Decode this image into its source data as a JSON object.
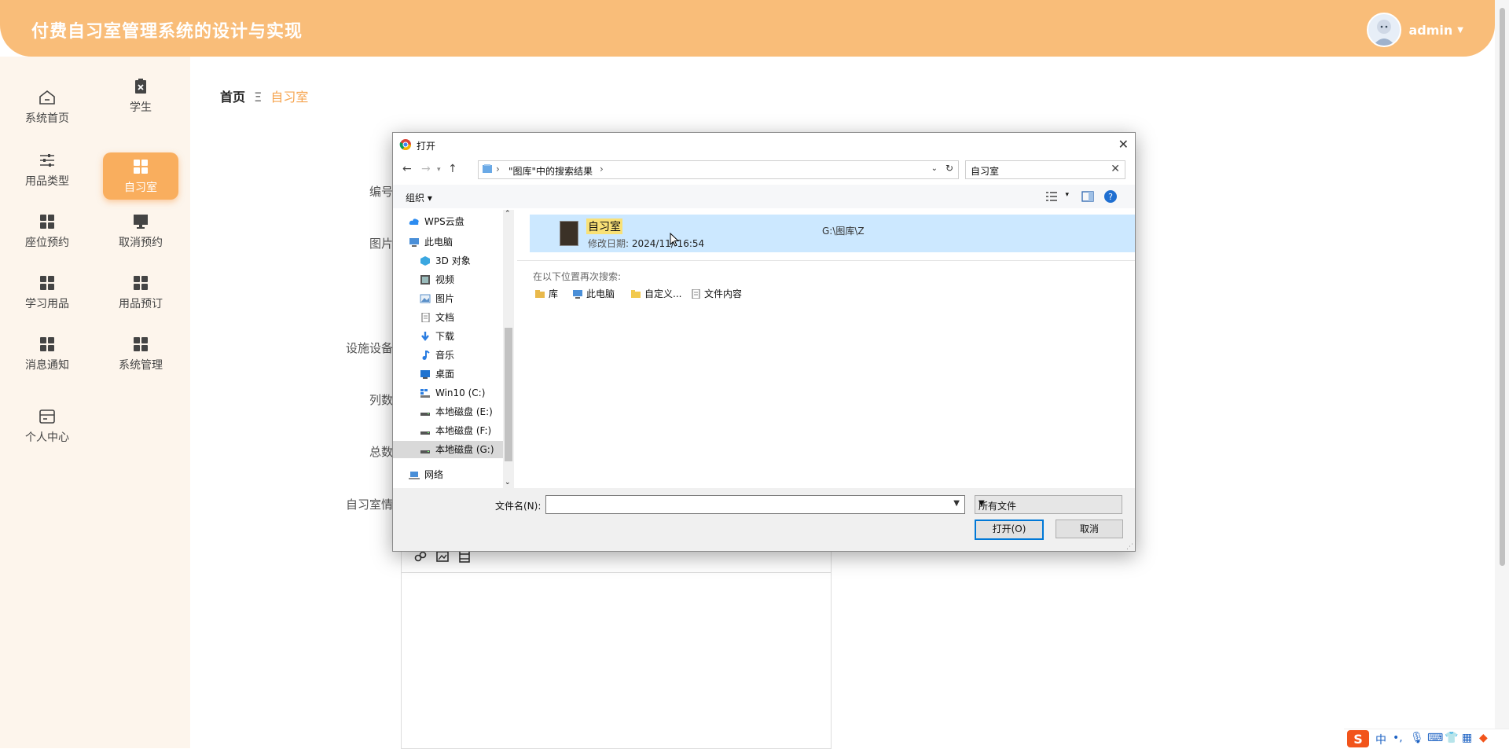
{
  "header": {
    "title": "付费自习室管理系统的设计与实现",
    "user": "admin"
  },
  "sidebar": {
    "items": [
      {
        "label": "系统首页",
        "icon": "home-icon"
      },
      {
        "label": "学生",
        "icon": "clipboard-icon"
      },
      {
        "label": "用品类型",
        "icon": "sliders-icon"
      },
      {
        "label": "自习室",
        "icon": "grid-icon",
        "active": true
      },
      {
        "label": "座位预约",
        "icon": "grid-icon"
      },
      {
        "label": "取消预约",
        "icon": "monitor-icon"
      },
      {
        "label": "学习用品",
        "icon": "grid-icon"
      },
      {
        "label": "用品预订",
        "icon": "grid-icon"
      },
      {
        "label": "消息通知",
        "icon": "grid-icon"
      },
      {
        "label": "系统管理",
        "icon": "grid-icon"
      },
      {
        "label": "个人中心",
        "icon": "card-icon"
      }
    ]
  },
  "breadcrumb": {
    "home": "首页",
    "separator": "Ξ",
    "current": "自习室"
  },
  "form": {
    "labels": {
      "number": "编号",
      "picture": "图片",
      "facilities": "设施设备",
      "columns": "列数",
      "total": "总数",
      "details": "自习室情"
    }
  },
  "dialog": {
    "title": "打开",
    "address": {
      "text": "\"图库\"中的搜索结果"
    },
    "search": {
      "value": "自习室"
    },
    "organize": "组织",
    "tree": [
      {
        "label": "WPS云盘",
        "icon": "cloud-icon"
      },
      {
        "label": "此电脑",
        "icon": "computer-icon"
      },
      {
        "label": "3D 对象",
        "icon": "cube-icon"
      },
      {
        "label": "视频",
        "icon": "video-icon"
      },
      {
        "label": "图片",
        "icon": "picture-icon"
      },
      {
        "label": "文档",
        "icon": "document-icon"
      },
      {
        "label": "下载",
        "icon": "download-icon"
      },
      {
        "label": "音乐",
        "icon": "music-icon"
      },
      {
        "label": "桌面",
        "icon": "desktop-icon"
      },
      {
        "label": "Win10 (C:)",
        "icon": "windows-drive-icon"
      },
      {
        "label": "本地磁盘 (E:)",
        "icon": "drive-icon"
      },
      {
        "label": "本地磁盘 (F:)",
        "icon": "drive-icon"
      },
      {
        "label": "本地磁盘 (G:)",
        "icon": "drive-icon",
        "selected": true
      },
      {
        "label": "网络",
        "icon": "network-icon"
      }
    ],
    "result": {
      "name": "自习室",
      "modified_label": "修改日期:",
      "modified": "2024/11/",
      "time": "16:54",
      "path": "G:\\图库\\Z"
    },
    "search_again": "在以下位置再次搜索:",
    "locations": [
      {
        "label": "库",
        "icon": "library-icon"
      },
      {
        "label": "此电脑",
        "icon": "computer-icon"
      },
      {
        "label": "自定义...",
        "icon": "folder-icon"
      },
      {
        "label": "文件内容",
        "icon": "document-icon"
      }
    ],
    "filename_label": "文件名(N):",
    "filename_value": "",
    "filetype": "所有文件",
    "open_button": "打开(O)",
    "cancel_button": "取消"
  },
  "tray": {
    "ime": "中"
  },
  "colors": {
    "header": "#f9bd79",
    "active_menu": "#f9ae5e",
    "accent_text": "#f6a44f",
    "selection": "#cce8ff"
  }
}
